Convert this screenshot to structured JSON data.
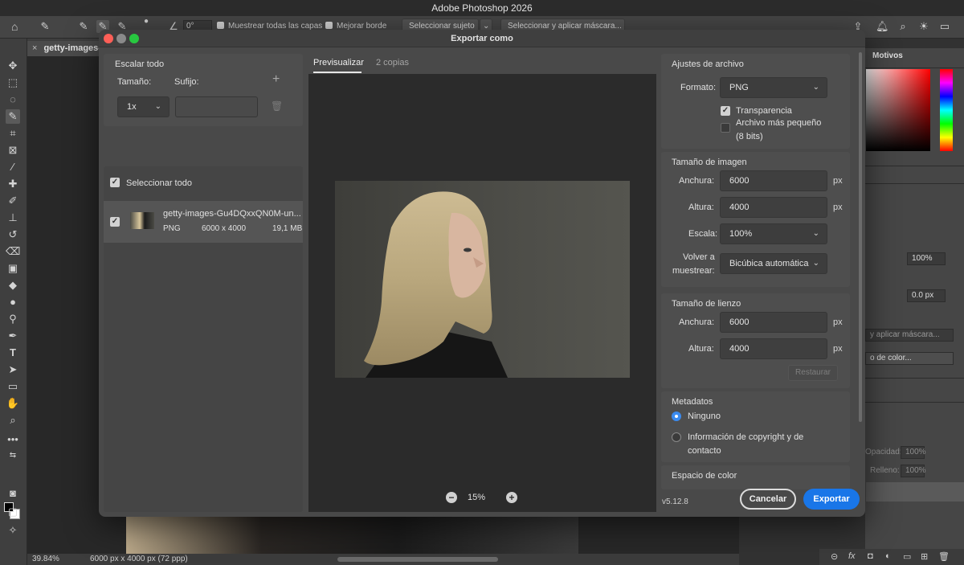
{
  "app": {
    "title": "Adobe Photoshop 2026"
  },
  "options_bar": {
    "angle": "0°",
    "sample_all_layers": "Muestrear todas las capas",
    "enhance_edge": "Mejorar borde",
    "select_subject": "Seleccionar sujeto",
    "select_and_mask": "Seleccionar y aplicar máscara..."
  },
  "document_tab": {
    "name": "getty-images-"
  },
  "status_bar": {
    "zoom": "39.84%",
    "dims": "6000 px x 4000 px (72 ppp)"
  },
  "right_panels": {
    "motivos_tab": "Motivos",
    "opacity_value": "100%",
    "feather_value": "0.0 px",
    "select_mask_button": "y aplicar máscara...",
    "color_button": "o de color...",
    "opacity_label": "Opacidad:",
    "opacity_field": "100%",
    "fill_label": "Relleno:",
    "fill_field": "100%"
  },
  "dialog": {
    "title": "Exportar como",
    "traffic_colors": {
      "close": "#fe5f57",
      "minimize": "#8a8a8a",
      "zoom": "#28c840"
    },
    "scale_all": {
      "heading": "Escalar todo",
      "size_label": "Tamaño:",
      "suffix_label": "Sufijo:",
      "size_value": "1x",
      "suffix_value": ""
    },
    "select_all_label": "Seleccionar todo",
    "file": {
      "name": "getty-images-Gu4DQxxQN0M-un...",
      "format": "PNG",
      "dims": "6000 x 4000",
      "size": "19,1 MB"
    },
    "preview": {
      "tab_preview": "Previsualizar",
      "tab_copies": "2 copias",
      "zoom": "15%"
    },
    "file_settings": {
      "heading": "Ajustes de archivo",
      "format_label": "Formato:",
      "format_value": "PNG",
      "transparency": "Transparencia",
      "transparency_checked": true,
      "smaller_file": "Archivo más pequeño",
      "smaller_file_bits": "(8 bits)",
      "smaller_file_checked": false
    },
    "image_size": {
      "heading": "Tamaño de imagen",
      "width_label": "Anchura:",
      "width_value": "6000",
      "height_label": "Altura:",
      "height_value": "4000",
      "unit": "px",
      "scale_label": "Escala:",
      "scale_value": "100%",
      "resample_label_1": "Volver a",
      "resample_label_2": "muestrear:",
      "resample_value": "Bicúbica automática"
    },
    "canvas_size": {
      "heading": "Tamaño de lienzo",
      "width_label": "Anchura:",
      "width_value": "6000",
      "height_label": "Altura:",
      "height_value": "4000",
      "unit": "px",
      "restore_button": "Restaurar"
    },
    "metadata": {
      "heading": "Metadatos",
      "option_none": "Ninguno",
      "option_copyright_1": "Información de copyright y de",
      "option_copyright_2": "contacto",
      "selected": "Ninguno"
    },
    "color_space": {
      "heading": "Espacio de color"
    },
    "version": "v5.12.8",
    "cancel_button": "Cancelar",
    "export_button": "Exportar",
    "accent_color": "#1976e8"
  }
}
